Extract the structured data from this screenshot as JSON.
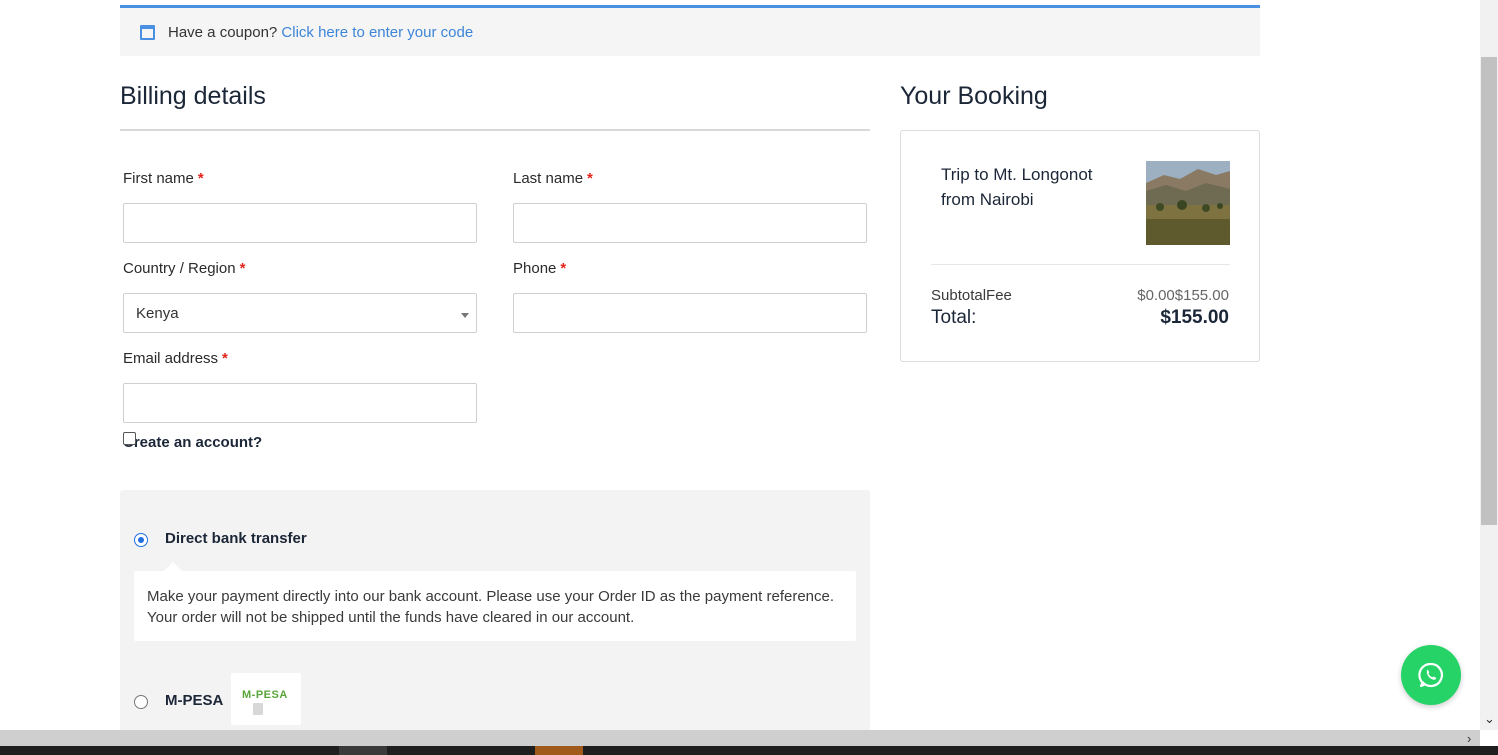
{
  "coupon": {
    "prompt": "Have a coupon?",
    "link": "Click here to enter your code",
    "icon": "calendar-icon"
  },
  "billing": {
    "title": "Billing details",
    "first_name_label": "First name",
    "last_name_label": "Last name",
    "country_label": "Country / Region",
    "country_value": "Kenya",
    "phone_label": "Phone",
    "email_label": "Email address",
    "required_mark": "*",
    "create_account_label": "Create an account?"
  },
  "payment": {
    "methods": [
      {
        "label": "Direct bank transfer",
        "selected": true,
        "description": "Make your payment directly into our bank account. Please use your Order ID as the payment reference. Your order will not be shipped until the funds have cleared in our account."
      },
      {
        "label": "M-PESA",
        "selected": false,
        "logo_text": "M-PESA"
      }
    ]
  },
  "booking": {
    "title": "Your Booking",
    "trip_name": "Trip to Mt. Longonot from Nairobi",
    "subtotal_label": "SubtotalFee",
    "subtotal_value": "$0.00$155.00",
    "total_label": "Total:",
    "total_value": "$155.00"
  },
  "colors": {
    "link": "#3d85d8",
    "coupon_border": "#4a90e2",
    "required": "#e2231a",
    "radio_selected": "#1f6fe0",
    "whatsapp": "#25d366"
  },
  "floating": {
    "whatsapp_icon": "whatsapp-icon"
  }
}
